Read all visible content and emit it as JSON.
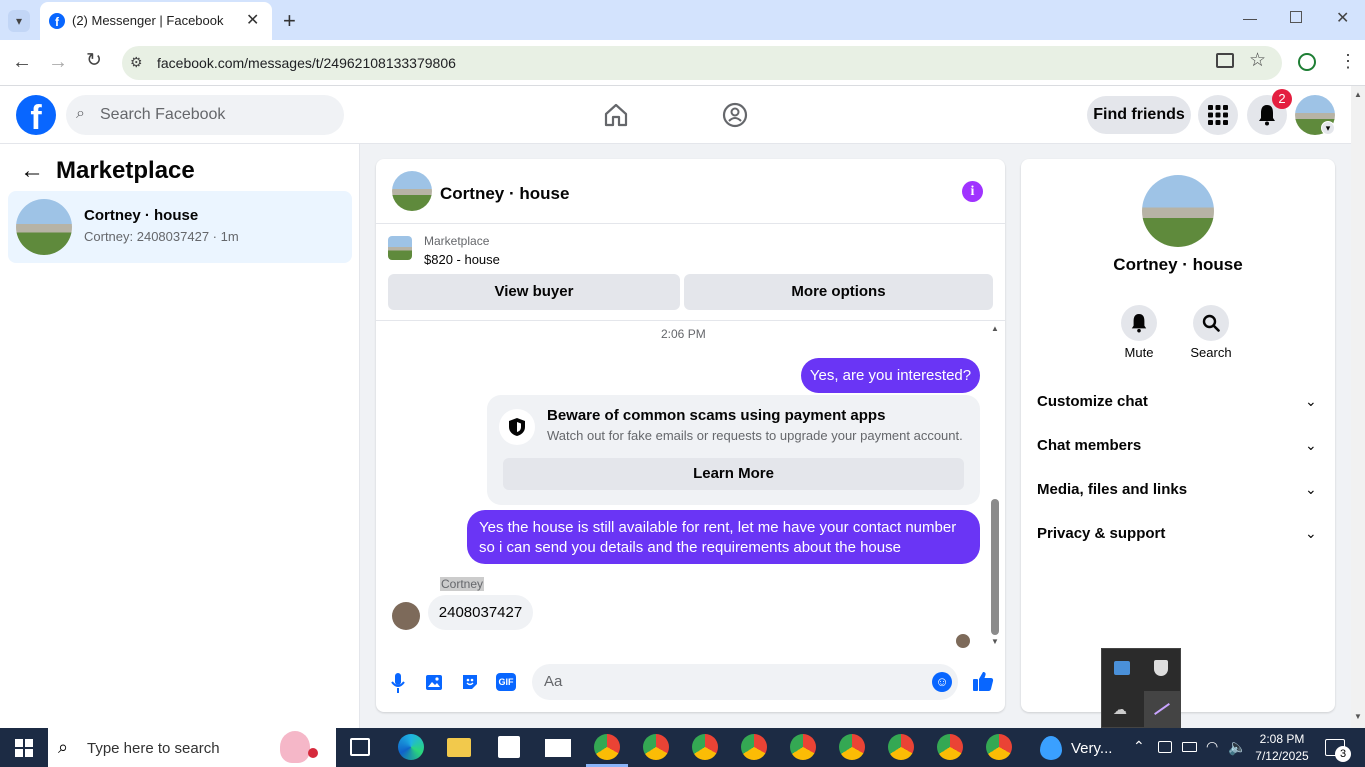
{
  "browser": {
    "tab_title": "(2) Messenger | Facebook",
    "url": "facebook.com/messages/t/24962108133379806"
  },
  "fb": {
    "search_placeholder": "Search Facebook",
    "find_friends": "Find friends",
    "notif_count": "2"
  },
  "left": {
    "title": "Marketplace",
    "conversations": [
      {
        "name": "Cortney · house",
        "preview": "Cortney: 2408037427 · 1m"
      }
    ]
  },
  "chat": {
    "header_name": "Cortney · house",
    "listing_source": "Marketplace",
    "listing_title": "$820 - house",
    "view_buyer": "View buyer",
    "more_options": "More options",
    "timestamp": "2:06 PM",
    "msg1": "Yes, are you interested?",
    "warning_title": "Beware of common scams using payment apps",
    "warning_body": "Watch out for fake emails or requests to upgrade your payment account.",
    "learn_more": "Learn More",
    "msg2_line1": "Yes the house is still available for rent, let me have your contact number",
    "msg2_line2": "so i can send you details and the requirements about the house",
    "sender_name": "Cortney",
    "msg3": "2408037427",
    "composer_placeholder": "Aa",
    "gif_label": "GIF"
  },
  "info": {
    "name": "Cortney · house",
    "mute": "Mute",
    "search": "Search",
    "sections": [
      "Customize chat",
      "Chat members",
      "Media, files and links",
      "Privacy & support"
    ]
  },
  "taskbar": {
    "search_placeholder": "Type here to search",
    "weather": "Very...",
    "time": "2:08 PM",
    "date": "7/12/2025",
    "notif": "3"
  },
  "colors": {
    "fb_blue": "#0866ff",
    "bubble": "#6a35f5",
    "taskbar": "#1c2b44",
    "info_purple": "#a033ff"
  }
}
